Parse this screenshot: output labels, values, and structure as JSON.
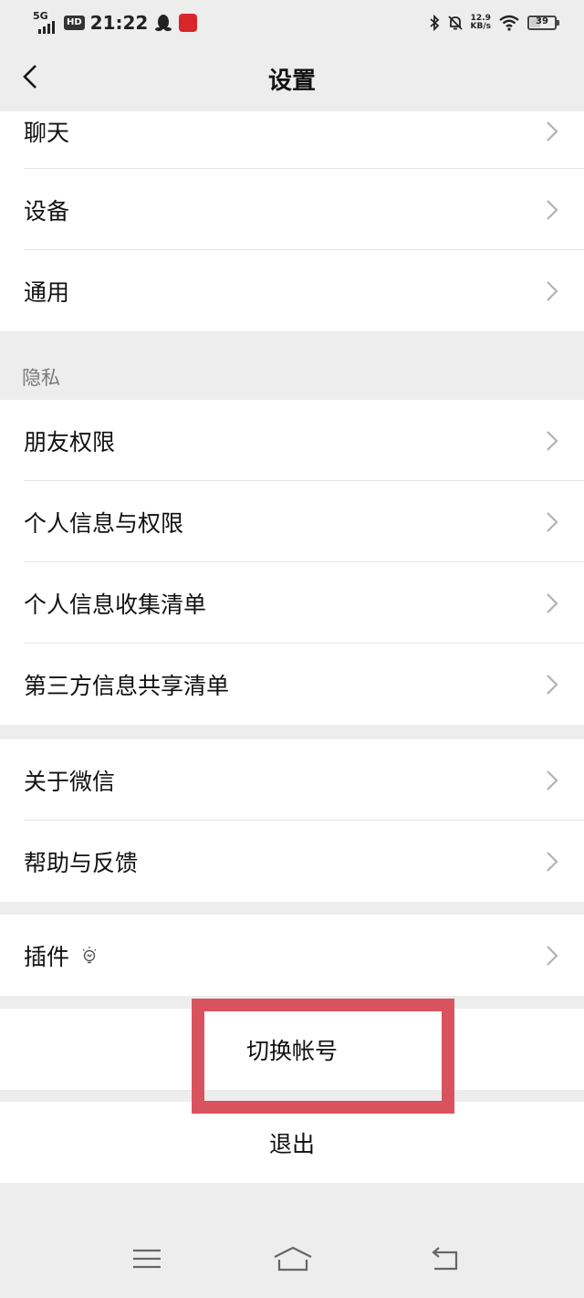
{
  "status_bar": {
    "network": "5G",
    "hd": "HD",
    "time": "21:22",
    "speed_value": "12.9",
    "speed_unit": "KB/s",
    "battery": "39"
  },
  "header": {
    "title": "设置"
  },
  "groups": {
    "general": [
      {
        "label": "聊天"
      },
      {
        "label": "设备"
      },
      {
        "label": "通用"
      }
    ],
    "privacy_label": "隐私",
    "privacy": [
      {
        "label": "朋友权限"
      },
      {
        "label": "个人信息与权限"
      },
      {
        "label": "个人信息收集清单"
      },
      {
        "label": "第三方信息共享清单"
      }
    ],
    "about": [
      {
        "label": "关于微信"
      },
      {
        "label": "帮助与反馈"
      }
    ],
    "plugins": {
      "label": "插件"
    }
  },
  "actions": {
    "switch_account": "切换帐号",
    "logout": "退出"
  },
  "colors": {
    "background": "#ededed",
    "card": "#ffffff",
    "highlight": "#d9535e"
  },
  "icons": {
    "back": "chevron-left-icon",
    "row_arrow": "chevron-right-icon",
    "plugin": "lightbulb-icon"
  }
}
